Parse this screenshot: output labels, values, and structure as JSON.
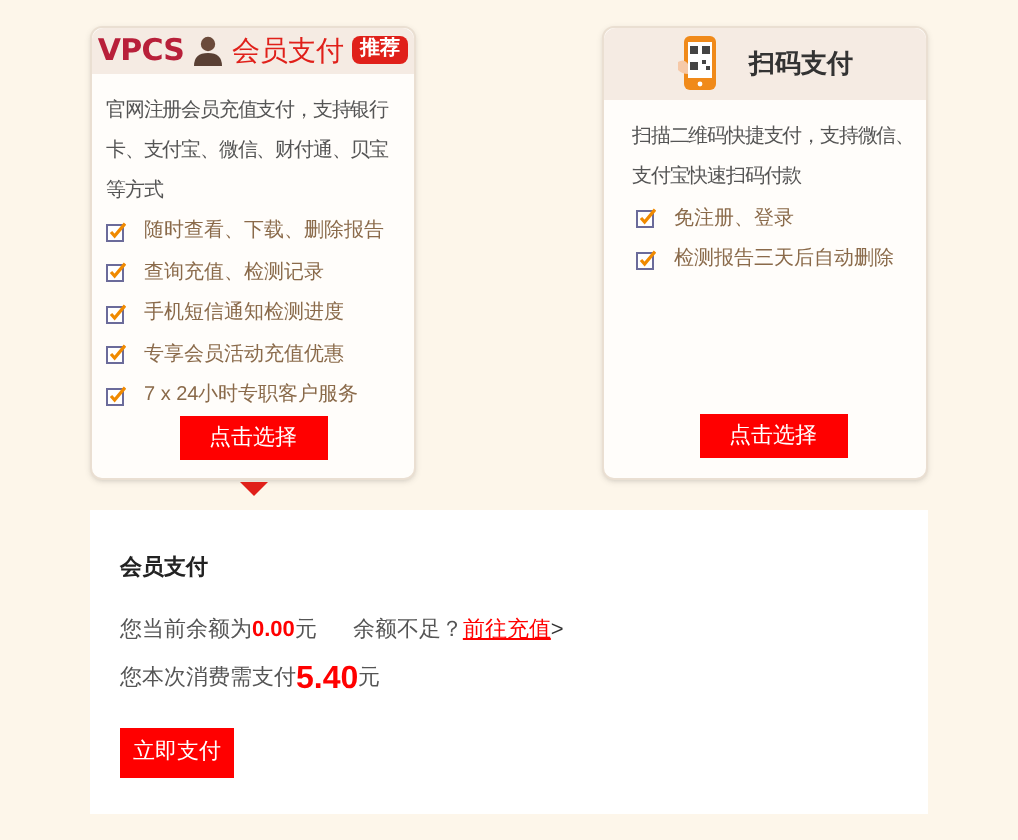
{
  "cards": [
    {
      "kind": "member",
      "logo": "VPCS",
      "title": "会员支付",
      "badge": "推荐",
      "selected": true,
      "description": "官网注册会员充值支付，支持银行卡、支付宝、微信、财付通、贝宝等方式",
      "features": [
        "随时查看、下载、删除报告",
        "查询充值、检测记录",
        "手机短信通知检测进度",
        "专享会员活动充值优惠",
        "7 x 24小时专职客户服务"
      ],
      "button": "点击选择"
    },
    {
      "kind": "scan",
      "title": "扫码支付",
      "selected": false,
      "description": "扫描二维码快捷支付，支持微信、支付宝快速扫码付款",
      "features": [
        "免注册、登录",
        "检测报告三天后自动删除"
      ],
      "button": "点击选择"
    }
  ],
  "payment": {
    "title": "会员支付",
    "balance": "您当前余额为**0.00**元",
    "insufficient": "余额不足？",
    "recharge_link": "前往充值",
    "link_arrow": ">",
    "due_label": "您本次消费需支付",
    "due_amount": "5.40",
    "due_unit": "元",
    "button": "立即支付"
  }
}
